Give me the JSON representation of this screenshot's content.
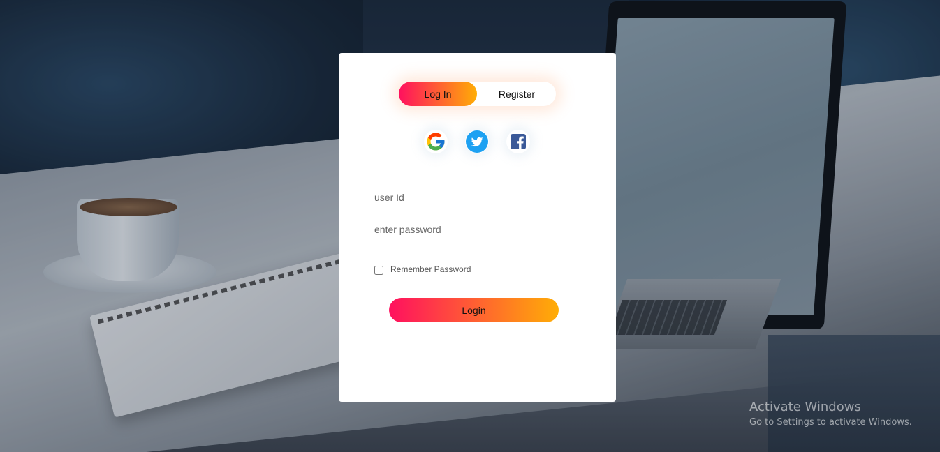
{
  "tabs": {
    "login_label": "Log In",
    "register_label": "Register",
    "active": "Log In"
  },
  "social": {
    "icons": [
      "google-icon",
      "twitter-icon",
      "facebook-icon"
    ]
  },
  "form": {
    "user_id": {
      "placeholder": "user Id",
      "value": ""
    },
    "password": {
      "placeholder": "enter password",
      "value": ""
    },
    "remember_label": "Remember Password",
    "remember_checked": false,
    "submit_label": "Login"
  },
  "colors": {
    "gradient_start": "#ff105f",
    "gradient_end": "#ffad06",
    "twitter_blue": "#1da1f2",
    "facebook_blue": "#3b5998"
  },
  "watermark": {
    "title": "Activate Windows",
    "subtitle": "Go to Settings to activate Windows."
  }
}
